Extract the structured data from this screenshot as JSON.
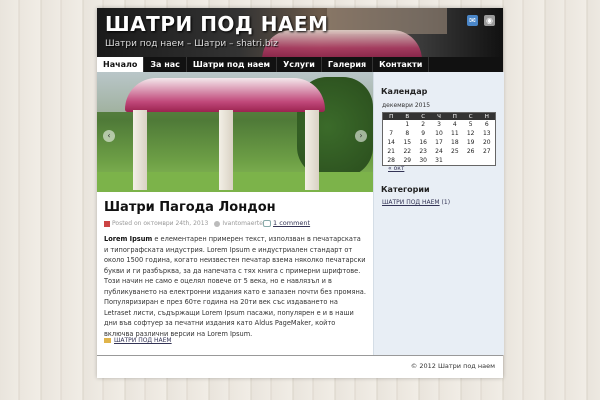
{
  "header": {
    "title": "ШАТРИ ПОД НАЕМ",
    "description": "Шатри под наем – Шатри – shatri.biz",
    "icons": [
      "mail-icon",
      "rss-icon"
    ]
  },
  "nav": {
    "items": [
      {
        "label": "Начало",
        "active": true
      },
      {
        "label": "За нас"
      },
      {
        "label": "Шатри под наем"
      },
      {
        "label": "Услуги"
      },
      {
        "label": "Галерия"
      },
      {
        "label": "Контакти"
      }
    ]
  },
  "slider": {
    "prev": "‹",
    "next": "›"
  },
  "post": {
    "title": "Шатри Пагода Лондон",
    "date": "Posted on октомври 24th, 2013",
    "author": "Ivantomaerte",
    "comments": "1 comment",
    "body_lead": "Lorem Ipsum",
    "body_rest": " е елементарен примерен текст, използван в печатарската и типографската индустрия. Lorem Ipsum е индустриален стандарт от около 1500 година, когато неизвестен печатар взема няколко печатарски букви и ги разбърква, за да напечата с тях книга с примерни шрифтове. Този начин не само е оцелял повече от 5 века, но е навлязъл и в публикуването на електронни издания като е запазен почти без промяна. Популяризиран е през 60те година на 20ти век със издаването на Letraset листи, съдържащи Lorem Ipsum пасажи, популярен е и в наши дни във софтуер за печатни издания като Aldus PageMaker, който включва различни версии на Lorem Ipsum.",
    "category": "ШАТРИ ПОД НАЕМ"
  },
  "sidebar": {
    "calendar_title": "Календар",
    "calendar_caption": "декември 2015",
    "weekdays": [
      "П",
      "В",
      "С",
      "Ч",
      "П",
      "С",
      "Н"
    ],
    "weeks": [
      [
        "",
        "1",
        "2",
        "3",
        "4",
        "5",
        "6"
      ],
      [
        "7",
        "8",
        "9",
        "10",
        "11",
        "12",
        "13"
      ],
      [
        "14",
        "15",
        "16",
        "17",
        "18",
        "19",
        "20"
      ],
      [
        "21",
        "22",
        "23",
        "24",
        "25",
        "26",
        "27"
      ],
      [
        "28",
        "29",
        "30",
        "31",
        "",
        "",
        ""
      ]
    ],
    "prev_link": "« окт",
    "categories_title": "Категории",
    "category_link": "ШАТРИ ПОД НАЕМ",
    "category_count": " (1)"
  },
  "footer": {
    "copyright": "© 2012 Шатри под наем"
  }
}
